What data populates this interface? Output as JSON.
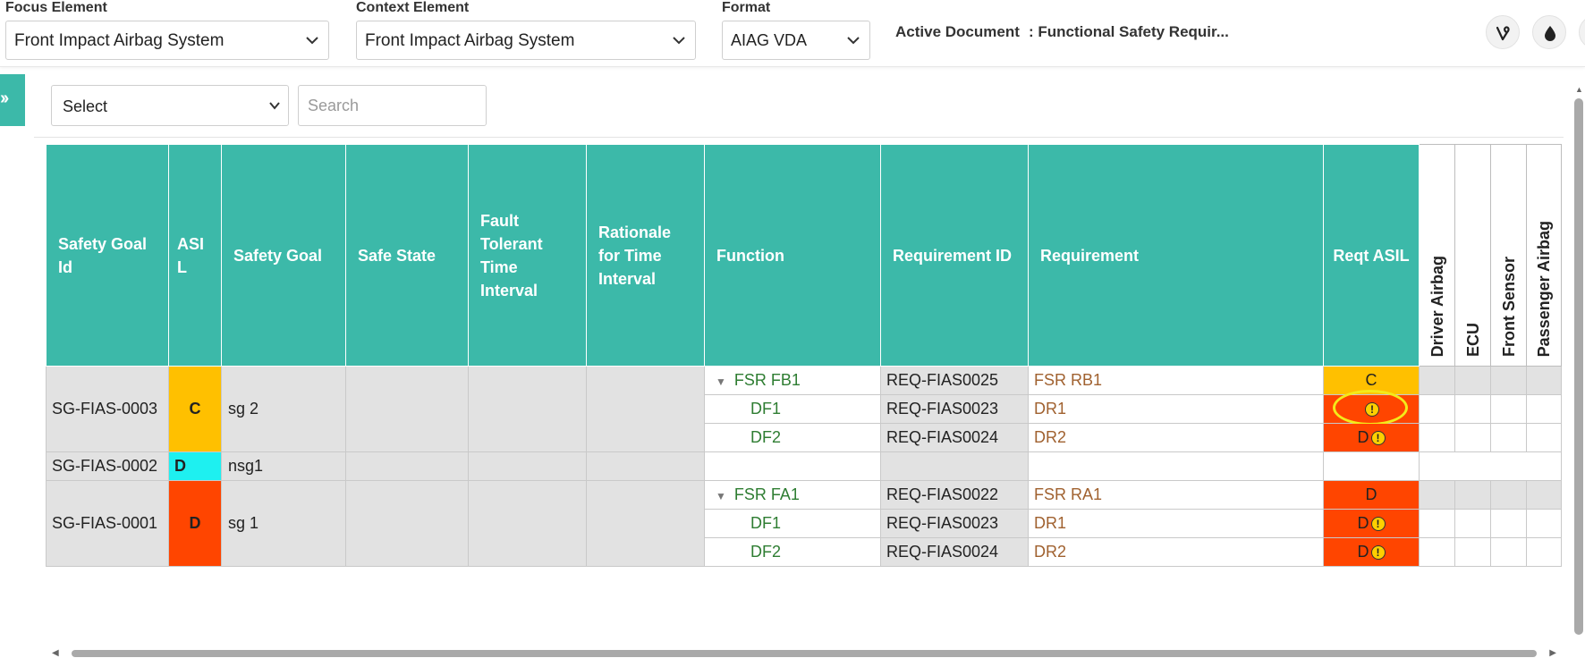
{
  "toolbar": {
    "focus_label": "Focus Element",
    "focus_value": "Front Impact Airbag System",
    "context_label": "Context Element",
    "context_value": "Front Impact Airbag System",
    "format_label": "Format",
    "format_value": "AIAG VDA",
    "active_doc_label": "Active Document",
    "active_doc_value": ": Functional Safety Requir..."
  },
  "filter": {
    "select_value": "Select",
    "search_placeholder": "Search"
  },
  "table": {
    "headers": {
      "sg_id": "Safety Goal Id",
      "asil": "ASI L",
      "safety_goal": "Safety Goal",
      "safe_state": "Safe State",
      "ftti": "Fault Tolerant Time Interval",
      "rationale": "Rationale for Time Interval",
      "function": "Function",
      "req_id": "Requirement ID",
      "requirement": "Requirement",
      "req_asil": "Reqt ASIL",
      "tools": [
        "Driver Airbag",
        "ECU",
        "Front Sensor",
        "Passenger Airbag"
      ]
    },
    "groups": [
      {
        "sg_id": "SG-FIAS-0003",
        "asil": "C",
        "asil_color": "#ffc000",
        "safety_goal": "sg 2",
        "rows": [
          {
            "function": "FSR FB1",
            "req_id": "REQ-FIAS0025",
            "requirement": "FSR RB1",
            "req_asil": "C",
            "warn": false
          },
          {
            "function": "DF1",
            "req_id": "REQ-FIAS0023",
            "requirement": "DR1",
            "req_asil": "",
            "warn": true
          },
          {
            "function": "DF2",
            "req_id": "REQ-FIAS0024",
            "requirement": "DR2",
            "req_asil": "D",
            "warn": true
          }
        ]
      },
      {
        "sg_id": "SG-FIAS-0002",
        "asil": "D",
        "asil_color": "#1ef0f0",
        "safety_goal": "nsg1",
        "rows": []
      },
      {
        "sg_id": "SG-FIAS-0001",
        "asil": "D",
        "asil_color": "#ff4500",
        "safety_goal": "sg 1",
        "rows": [
          {
            "function": "FSR FA1",
            "req_id": "REQ-FIAS0022",
            "requirement": "FSR RA1",
            "req_asil": "D",
            "warn": false
          },
          {
            "function": "DF1",
            "req_id": "REQ-FIAS0023",
            "requirement": "DR1",
            "req_asil": "D",
            "warn": true
          },
          {
            "function": "DF2",
            "req_id": "REQ-FIAS0024",
            "requirement": "DR2",
            "req_asil": "D",
            "warn": true
          }
        ]
      }
    ]
  },
  "colors": {
    "header": "#3cb9a9",
    "asil_c": "#ffc000",
    "asil_d": "#ff4500",
    "asil_d_light": "#1ef0f0",
    "function_text": "#2e7d32",
    "requirement_text": "#a0612f"
  },
  "icons": {
    "sidebar_toggle": "double-chevron-right-icon",
    "btn1": "vine-icon",
    "btn2": "drop-icon",
    "warning": "warning-icon"
  }
}
